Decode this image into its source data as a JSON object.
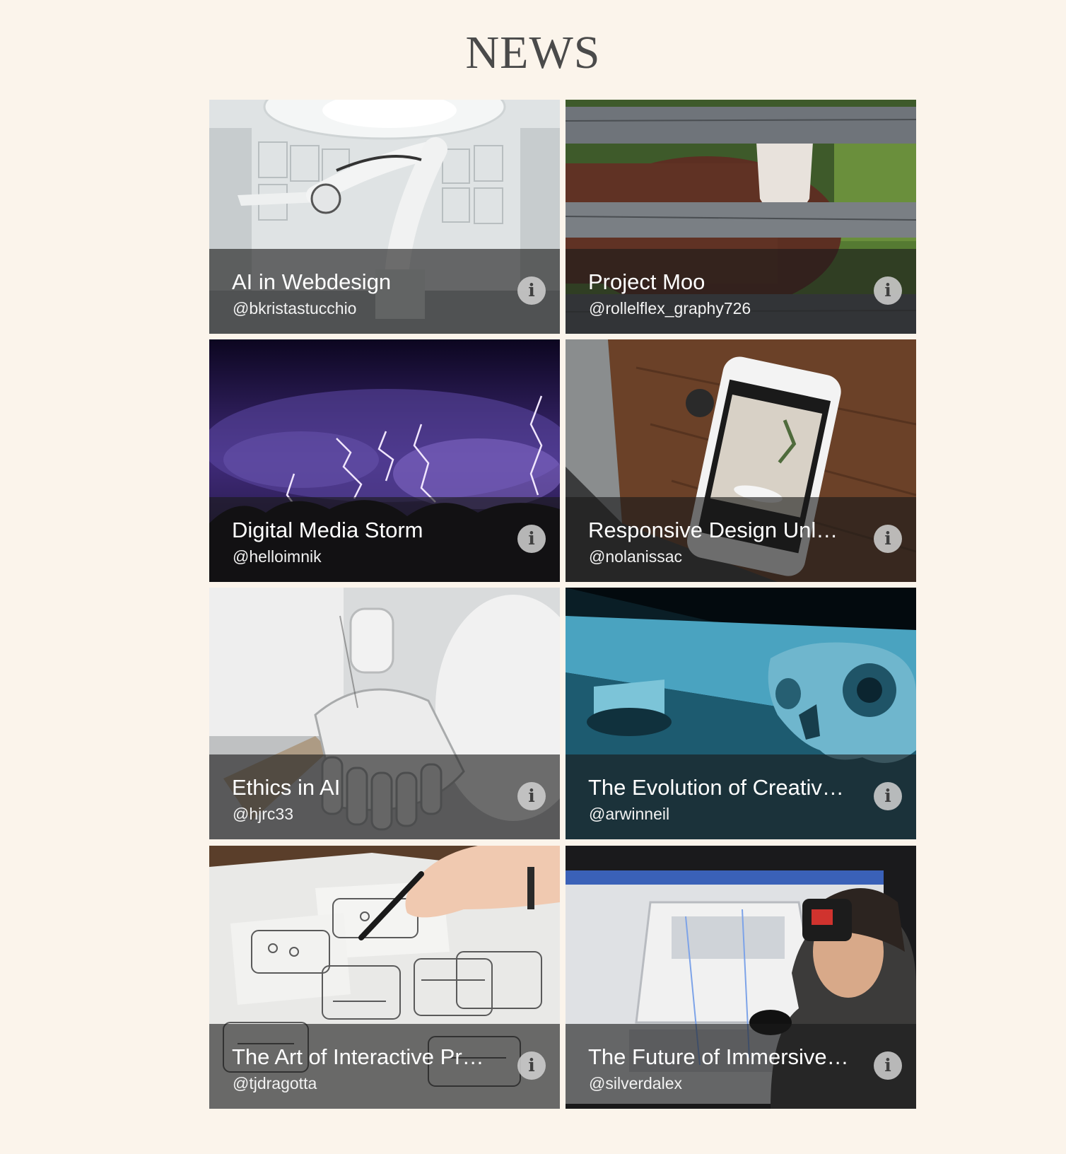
{
  "page": {
    "title": "NEWS"
  },
  "cards": [
    {
      "title": "AI in Webdesign",
      "author": "@bkristastucchio",
      "image": "robotic arm in white lab",
      "info_icon": "info-icon"
    },
    {
      "title": "Project Moo",
      "author": "@rollelflex_graphy726",
      "image": "cow behind wooden fence",
      "info_icon": "info-icon"
    },
    {
      "title": "Digital Media Storm",
      "author": "@helloimnik",
      "image": "purple lightning storm",
      "info_icon": "info-icon"
    },
    {
      "title": "Responsive Design Unleashed",
      "author": "@nolanissac",
      "image": "smartphone on wooden table",
      "info_icon": "info-icon"
    },
    {
      "title": "Ethics in AI",
      "author": "@hjrc33",
      "image": "white robot hand",
      "info_icon": "info-icon"
    },
    {
      "title": "The Evolution of Creative Technology",
      "author": "@arwinneil",
      "image": "blue lit robot skull",
      "info_icon": "info-icon"
    },
    {
      "title": "The Art of Interactive Prototyping",
      "author": "@tjdragotta",
      "image": "hand sketching wireframes",
      "info_icon": "info-icon"
    },
    {
      "title": "The Future of Immersive Experiences",
      "author": "@silverdalex",
      "image": "man wearing VR headset",
      "info_icon": "info-icon"
    }
  ]
}
